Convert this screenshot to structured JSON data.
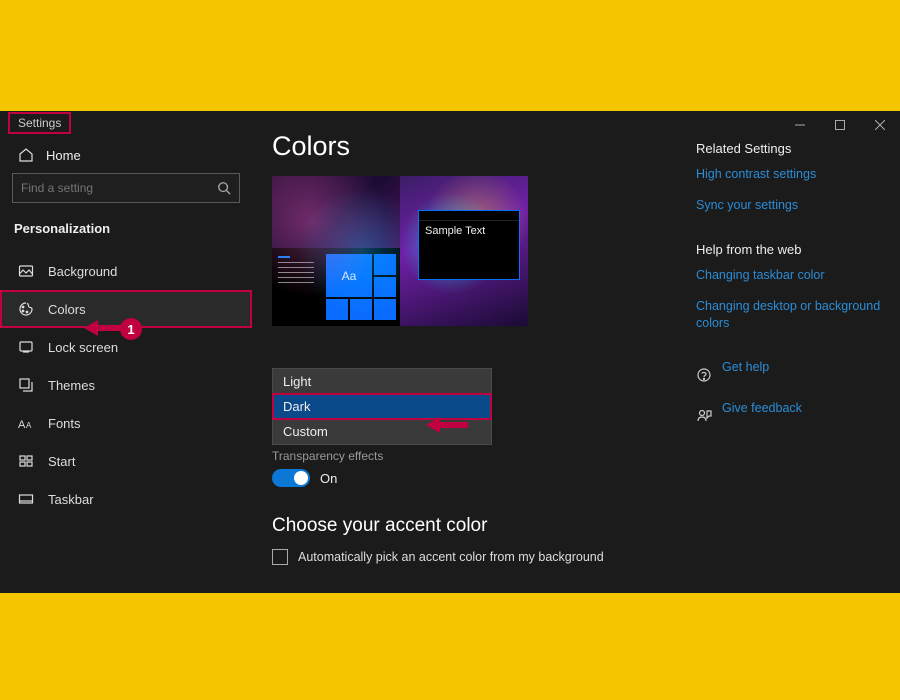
{
  "app_title": "Settings",
  "home_label": "Home",
  "search_placeholder": "Find a setting",
  "category": "Personalization",
  "nav": [
    {
      "id": "background",
      "label": "Background"
    },
    {
      "id": "colors",
      "label": "Colors"
    },
    {
      "id": "lockscreen",
      "label": "Lock screen"
    },
    {
      "id": "themes",
      "label": "Themes"
    },
    {
      "id": "fonts",
      "label": "Fonts"
    },
    {
      "id": "start",
      "label": "Start"
    },
    {
      "id": "taskbar",
      "label": "Taskbar"
    }
  ],
  "page_title": "Colors",
  "preview": {
    "tile_aa": "Aa",
    "sample_text": "Sample Text"
  },
  "color_mode_options": [
    "Light",
    "Dark",
    "Custom"
  ],
  "color_mode_selected": "Dark",
  "transparency_label": "Transparency effects",
  "transparency_value": "On",
  "accent_heading": "Choose your accent color",
  "auto_accent_label": "Automatically pick an accent color from my background",
  "rail": {
    "related_h": "Related Settings",
    "high_contrast": "High contrast settings",
    "sync": "Sync your settings",
    "help_h": "Help from the web",
    "help1": "Changing taskbar color",
    "help2": "Changing desktop or background colors",
    "get_help": "Get help",
    "feedback": "Give feedback"
  },
  "annotation_badge": "1"
}
